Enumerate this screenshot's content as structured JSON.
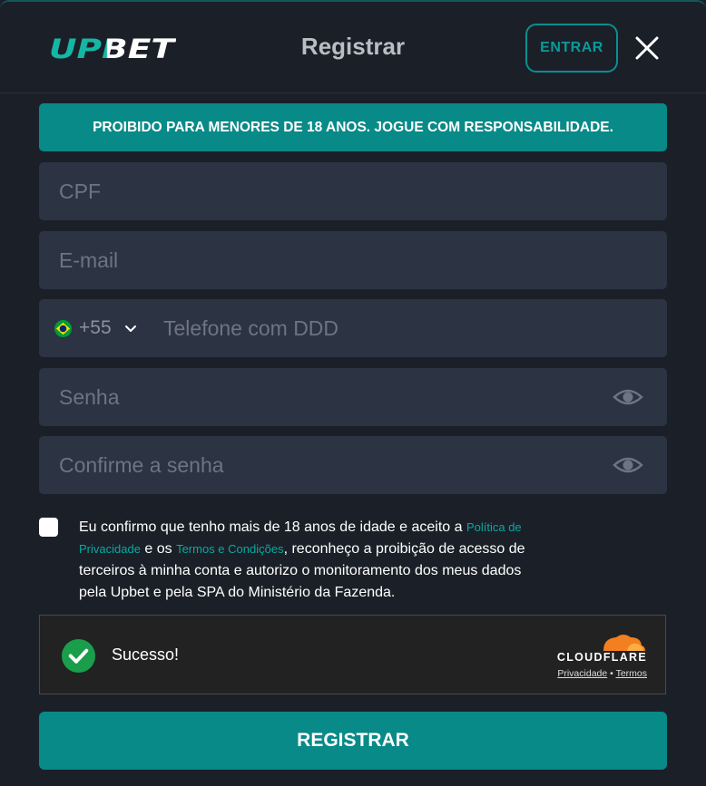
{
  "header": {
    "logo_text": "UPBET",
    "title": "Registrar",
    "login_button": "ENTRAR"
  },
  "banner": {
    "text": "PROIBIDO PARA MENORES DE 18 ANOS. JOGUE COM RESPONSABILIDADE."
  },
  "form": {
    "cpf_placeholder": "CPF",
    "email_placeholder": "E-mail",
    "phone": {
      "country_code": "+55",
      "placeholder": "Telefone com DDD"
    },
    "password_placeholder": "Senha",
    "confirm_password_placeholder": "Confirme a senha"
  },
  "consent": {
    "text_1": "Eu confirmo que tenho mais de 18 anos de idade e aceito a ",
    "privacy_link": "Política de Privacidade",
    "text_2": " e os ",
    "terms_link": "Termos e Condições",
    "text_3": ", reconheço a proibição de acesso de terceiros à minha conta e autorizo o monitoramento dos meus dados pela Upbet e pela SPA do Ministério da Fazenda."
  },
  "captcha": {
    "status": "Sucesso!",
    "brand": "CLOUDFLARE",
    "privacy_link": "Privacidade",
    "separator": "•",
    "terms_link": "Termos"
  },
  "submit_button": "REGISTRAR",
  "colors": {
    "background": "#1b2028",
    "accent": "#078a88",
    "field": "#2c3343",
    "link": "#0aa8a0"
  }
}
